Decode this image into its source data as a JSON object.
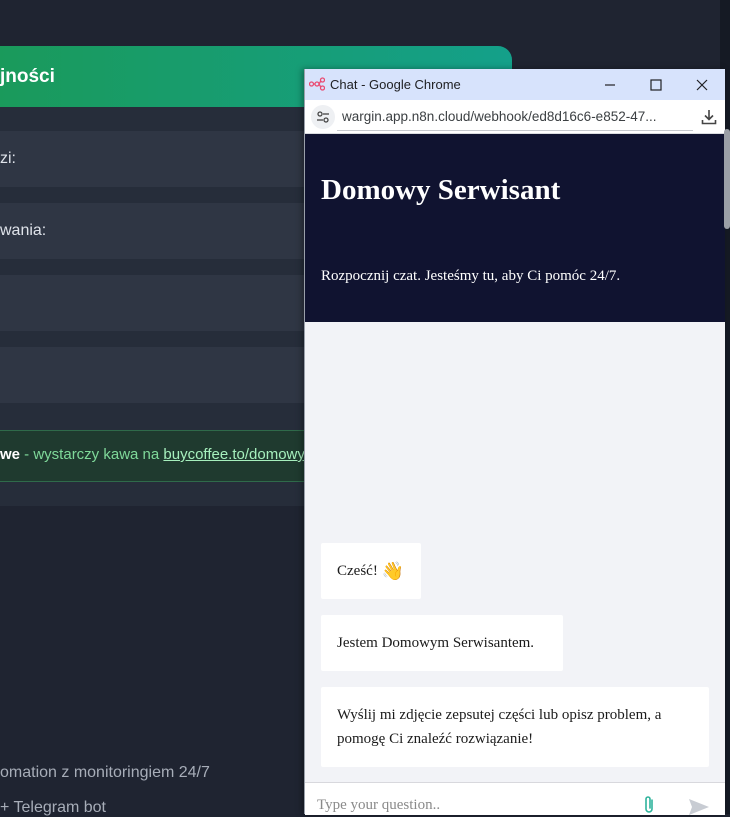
{
  "background": {
    "header_title": "jności",
    "row_labels": [
      "zi:",
      "wania:"
    ],
    "promo": {
      "bold": "we",
      "text": " - wystarczy kawa na ",
      "link": "buycoffee.to/domowy"
    },
    "footer_line1": "omation z monitoringiem 24/7",
    "footer_line2": "+ Telegram bot"
  },
  "window": {
    "title": "Chat - Google Chrome",
    "url": "wargin.app.n8n.cloud/webhook/ed8d16c6-e852-47..."
  },
  "chat": {
    "title": "Domowy Serwisant",
    "subtitle": "Rozpocznij czat. Jesteśmy tu, aby Ci pomóc 24/7.",
    "messages": [
      {
        "text": "Cześć!",
        "emoji": "👋"
      },
      {
        "text": "Jestem Domowym Serwisantem."
      },
      {
        "text": "Wyślij mi zdjęcie zepsutej części lub opisz problem, a pomogę Ci znaleźć rozwiązanie!"
      }
    ],
    "input_placeholder": "Type your question.."
  },
  "colors": {
    "header_bg": "#101330",
    "accent_green": "#1a9a5b",
    "titlebar": "#d7e3fc"
  }
}
